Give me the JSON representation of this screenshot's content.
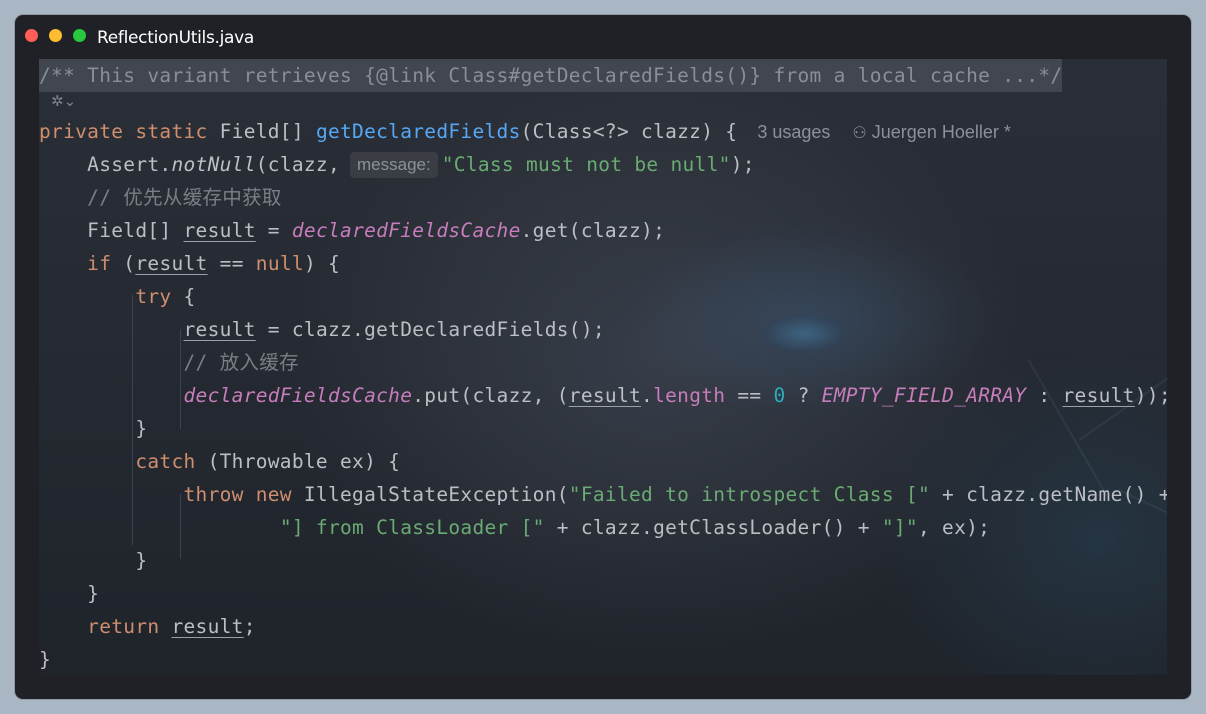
{
  "window": {
    "title": "ReflectionUtils.java",
    "traffic_lights": [
      "#ff5f57",
      "#febc2e",
      "#28c840"
    ]
  },
  "icons": {
    "gutter": "ai-sparkle-icon",
    "author": "user-icon"
  },
  "code": {
    "doc_comment": "/** This variant retrieves {@link Class#getDeclaredFields()} from a local cache ...*/",
    "sig_kw": "private static ",
    "sig_type": "Field[] ",
    "sig_name": "getDeclaredFields",
    "sig_params": "(Class<?> clazz) {",
    "usages": "3 usages",
    "author": "Juergen Hoeller *",
    "assert_call": "Assert.",
    "assert_method": "notNull",
    "assert_open": "(clazz,",
    "param_hint": "message:",
    "assert_msg": "\"Class must not be null\"",
    "assert_close": ");",
    "comment_cache": "// 优先从缓存中获取",
    "l4_type": "Field[] ",
    "var_result": "result",
    "assign": " = ",
    "cache_field": "declaredFieldsCache",
    "get_call": ".get(clazz);",
    "kw_if": "if",
    "if_open": " (",
    "eq": " == ",
    "kw_null": "null",
    "if_close": ") {",
    "kw_try": "try",
    "brace_open": " {",
    "get_fields": "clazz.getDeclaredFields();",
    "comment_put": "// 放入缓存",
    "put_call": ".put(clazz, (",
    "dot": ".",
    "length": "length",
    "zero": "0",
    "q": " ? ",
    "empty_array": "EMPTY_FIELD_ARRAY",
    "colon": " : ",
    "put_close": "));",
    "brace_close": "}",
    "kw_catch": "catch",
    "catch_args": " (Throwable ex) {",
    "kw_throw": "throw",
    "kw_new": " new ",
    "exc_type": "IllegalStateException(",
    "exc_str1": "\"Failed to introspect Class [\"",
    "exc_mid1": " + clazz.getName() +",
    "exc_str2": "\"] from ClassLoader [\"",
    "exc_mid2": " + clazz.getClassLoader() + ",
    "exc_str3": "\"]\"",
    "exc_end": ", ex);",
    "kw_return": "return",
    "semi": ";"
  }
}
